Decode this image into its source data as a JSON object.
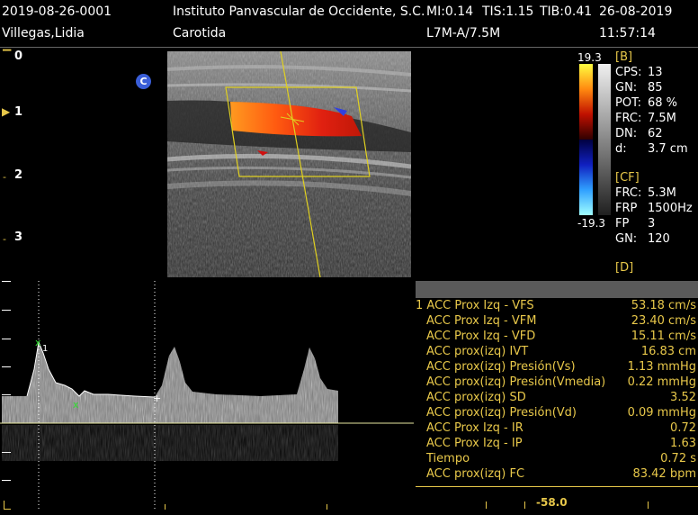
{
  "header": {
    "exam_id": "2019-08-26-0001",
    "institution": "Instituto Panvascular de Occidente, S.C.",
    "mi": "MI:0.14",
    "tis": "TIS:1.15",
    "tib": "TIB:0.41",
    "date": "26-08-2019",
    "patient": "Villegas,Lidia",
    "study": "Carotida",
    "probe": "L7M-A/7.5M",
    "time": "11:57:14"
  },
  "depth_scale": {
    "labels": [
      "0",
      "1",
      "2",
      "3"
    ],
    "focus_marker": "▶"
  },
  "image_badge": "C",
  "color_bar": {
    "top": "19.3",
    "bottom": "-19.3"
  },
  "params": {
    "b_title": "[B]",
    "b": [
      {
        "k": "CPS:",
        "v": "13"
      },
      {
        "k": "GN:",
        "v": "85"
      },
      {
        "k": "POT:",
        "v": "68 %"
      },
      {
        "k": "FRC:",
        "v": "7.5M"
      },
      {
        "k": "DN:",
        "v": "62"
      },
      {
        "k": "d:",
        "v": "3.7 cm"
      }
    ],
    "cf_title": "[CF]",
    "cf": [
      {
        "k": "FRC:",
        "v": "5.3M"
      },
      {
        "k": "FRP",
        "v": "1500Hz"
      },
      {
        "k": "FP",
        "v": "3"
      },
      {
        "k": "GN:",
        "v": "120"
      }
    ],
    "d_title": "[D]"
  },
  "measurements": {
    "rows": [
      {
        "label": "1 ACC Prox Izq - VFS",
        "value": "53.18 cm/s"
      },
      {
        "label": "ACC Prox Izq - VFM",
        "value": "23.40 cm/s"
      },
      {
        "label": "ACC Prox Izq - VFD",
        "value": "15.11 cm/s"
      },
      {
        "label": "ACC prox(izq) IVT",
        "value": "16.83 cm"
      },
      {
        "label": "ACC prox(izq) Presión(Vs)",
        "value": "1.13 mmHg"
      },
      {
        "label": "ACC prox(izq) Presión(Vmedia)",
        "value": "0.22 mmHg"
      },
      {
        "label": "ACC prox(izq) SD",
        "value": "3.52"
      },
      {
        "label": "ACC prox(izq) Presión(Vd)",
        "value": "0.09 mmHg"
      },
      {
        "label": "ACC Prox Izq - IR",
        "value": "0.72"
      },
      {
        "label": "ACC Prox Izq - IP",
        "value": "1.63"
      },
      {
        "label": "Tiempo",
        "value": "0.72 s"
      },
      {
        "label": "ACC prox(izq) FC",
        "value": "83.42 bpm"
      }
    ]
  },
  "doppler": {
    "cursor_label": "1",
    "scale_bottom": "-58.0"
  },
  "colors": {
    "accent_yellow": "#e8c84a",
    "roi_yellow": "#e0d020",
    "flow_red": "#e02010",
    "flow_orange": "#ffa020"
  }
}
